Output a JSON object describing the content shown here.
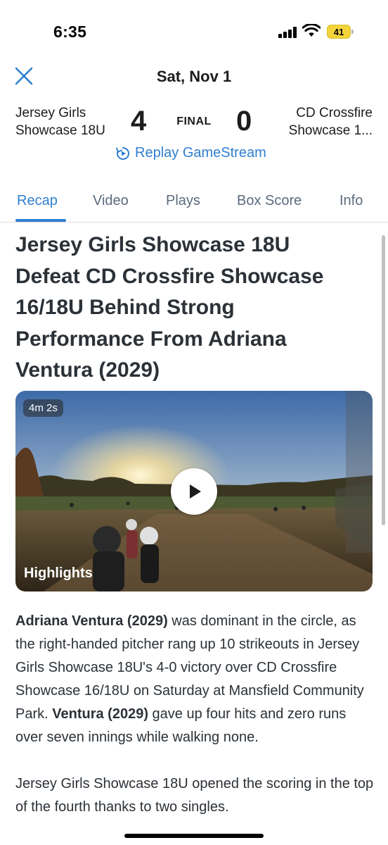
{
  "status_bar": {
    "time": "6:35",
    "battery": "41",
    "battery_color": "#f2d43b",
    "icons": [
      "cellular-signal-icon",
      "wifi-icon",
      "battery-icon"
    ]
  },
  "header": {
    "date": "Sat, Nov 1",
    "close_icon": "close-icon"
  },
  "scoreboard": {
    "home_team_line1": "Jersey Girls",
    "home_team_line2": "Showcase 18U",
    "home_score": "4",
    "status": "FINAL",
    "away_score": "0",
    "away_team_line1": "CD Crossfire",
    "away_team_line2": "Showcase 1...",
    "replay_label": "Replay GameStream",
    "replay_icon": "replay-icon"
  },
  "tabs": [
    {
      "label": "Recap",
      "active": true
    },
    {
      "label": "Video",
      "active": false
    },
    {
      "label": "Plays",
      "active": false
    },
    {
      "label": "Box Score",
      "active": false
    },
    {
      "label": "Info",
      "active": false
    }
  ],
  "article": {
    "headline_lines": [
      "Jersey Girls Showcase 18U",
      "Defeat CD Crossfire Showcase",
      "16/18U Behind Strong",
      "Performance From Adriana",
      "Ventura (2029)"
    ],
    "video": {
      "duration": "4m 2s",
      "label": "Highlights",
      "play_icon": "play-icon"
    },
    "paragraph1": {
      "bold1": "Adriana Ventura (2029)",
      "text1": " was dominant in the circle, as the right-handed pitcher rang up 10 strikeouts in Jersey Girls Showcase 18U's 4-0 victory over CD Crossfire Showcase 16/18U on Saturday at Mansfield Community Park. ",
      "bold2": "Ventura (2029)",
      "text2": " gave up four hits and zero runs over seven innings while walking none."
    },
    "paragraph2": "Jersey Girls Showcase 18U opened the scoring in the top of the fourth thanks to two singles."
  },
  "colors": {
    "accent": "#2f7fd0",
    "text": "#2b3137",
    "tab_inactive": "#5c6b7d"
  }
}
